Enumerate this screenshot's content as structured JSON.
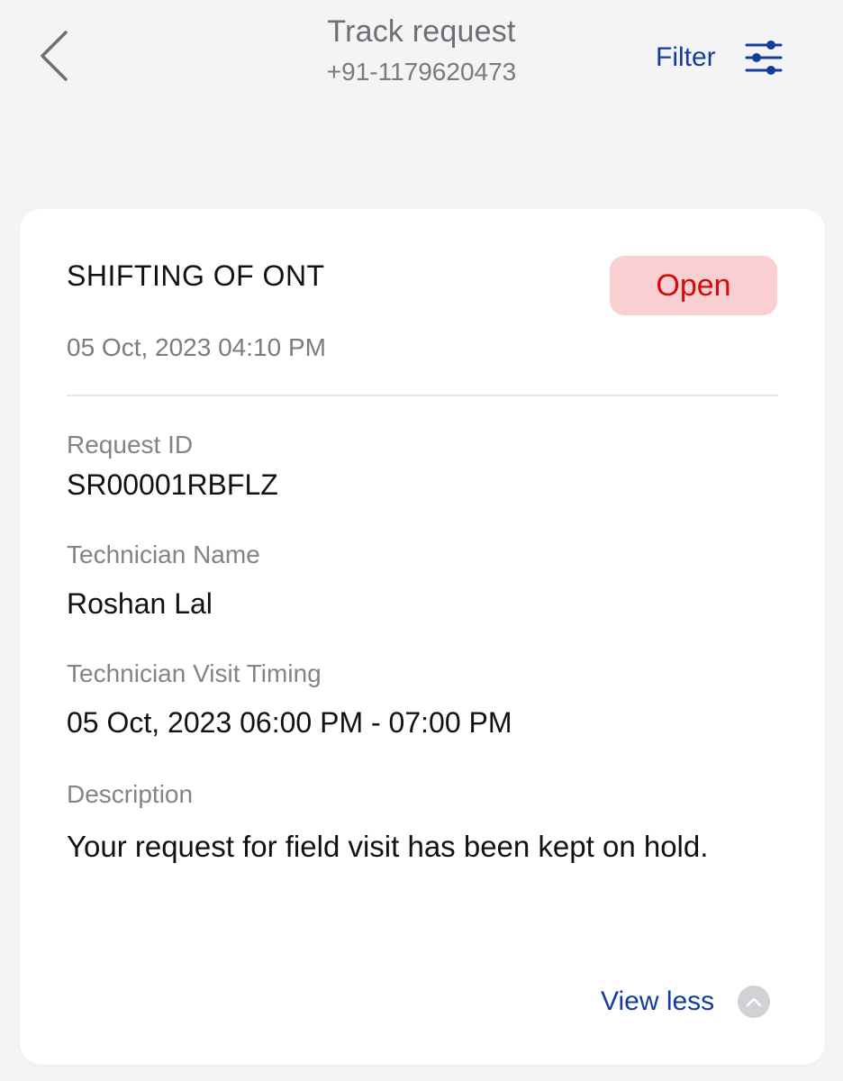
{
  "header": {
    "title": "Track request",
    "phone": "+91-1179620473",
    "filter_label": "Filter"
  },
  "request": {
    "type": "SHIFTING OF ONT",
    "status": "Open",
    "date": "05 Oct, 2023 04:10 PM",
    "request_id_label": "Request ID",
    "request_id": "SR00001RBFLZ",
    "technician_name_label": "Technician Name",
    "technician_name": "Roshan Lal",
    "visit_timing_label": "Technician Visit Timing",
    "visit_timing": "05 Oct, 2023 06:00 PM - 07:00 PM",
    "description_label": "Description",
    "description": "Your request for field visit has been kept on hold.",
    "view_less_label": "View less"
  },
  "colors": {
    "accent_blue": "#143c9c",
    "status_open_bg": "#f9cfd1",
    "status_open_text": "#d60a0a",
    "background": "#f4f4f6"
  },
  "icons": {
    "back": "chevron-left-icon",
    "filter": "sliders-icon",
    "view_less": "chevron-up-icon"
  }
}
